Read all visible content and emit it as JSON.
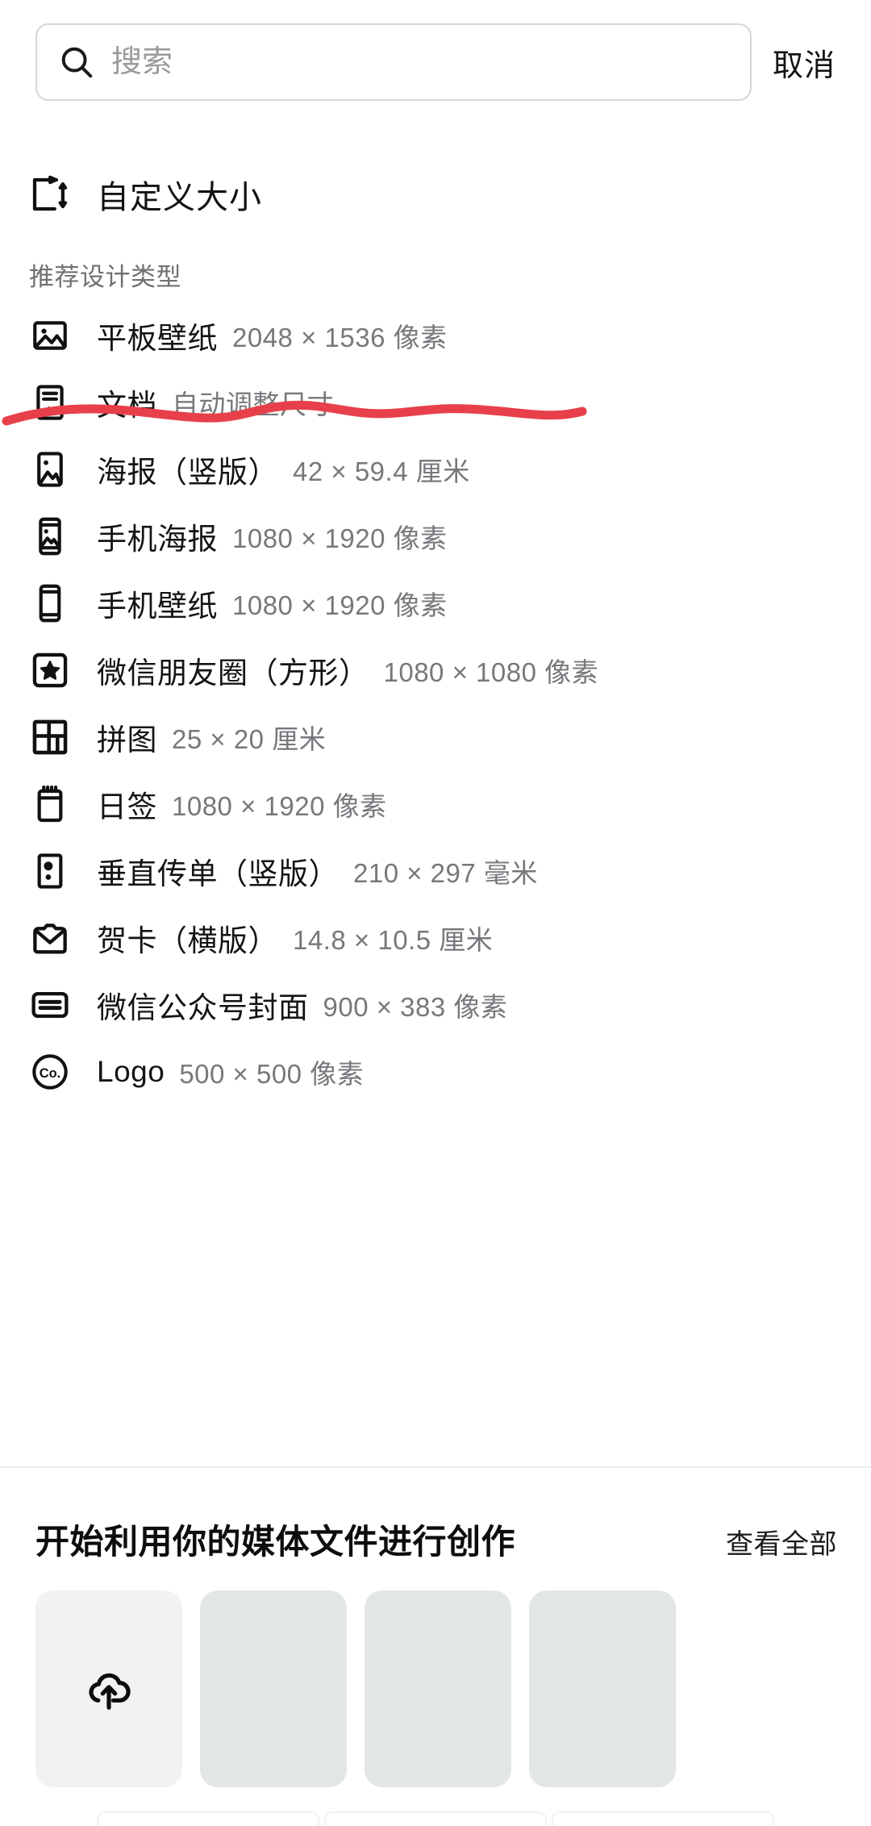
{
  "search": {
    "placeholder": "搜索",
    "value": "",
    "icon": "search-icon",
    "cancel_label": "取消"
  },
  "custom_size": {
    "label": "自定义大小",
    "icon": "resize-icon"
  },
  "section": {
    "header": "推荐设计类型"
  },
  "design_types": [
    {
      "icon": "image-icon",
      "label": "平板壁纸",
      "dimension": "2048 × 1536 像素"
    },
    {
      "icon": "document-icon",
      "label": "文档",
      "dimension": "自动调整尺寸"
    },
    {
      "icon": "poster-icon",
      "label": "海报（竖版）",
      "dimension": "42 × 59.4 厘米"
    },
    {
      "icon": "phone-poster-icon",
      "label": "手机海报",
      "dimension": "1080 × 1920 像素"
    },
    {
      "icon": "phone-icon",
      "label": "手机壁纸",
      "dimension": "1080 × 1920 像素"
    },
    {
      "icon": "star-square-icon",
      "label": "微信朋友圈（方形）",
      "dimension": "1080 × 1080 像素"
    },
    {
      "icon": "collage-icon",
      "label": "拼图",
      "dimension": "25 × 20 厘米"
    },
    {
      "icon": "notepad-icon",
      "label": "日签",
      "dimension": "1080 × 1920 像素"
    },
    {
      "icon": "flyer-icon",
      "label": "垂直传单（竖版）",
      "dimension": "210 × 297 毫米"
    },
    {
      "icon": "envelope-icon",
      "label": "贺卡（横版）",
      "dimension": "14.8 × 10.5 厘米"
    },
    {
      "icon": "wechat-cover-icon",
      "label": "微信公众号封面",
      "dimension": "900 × 383 像素"
    },
    {
      "icon": "logo-circle-icon",
      "label": "Logo",
      "dimension": "500 × 500 像素"
    }
  ],
  "annotation": {
    "type": "handdrawn-underline",
    "color": "#e8404a",
    "target": "平板壁纸"
  },
  "media_section": {
    "title": "开始利用你的媒体文件进行创作",
    "view_all_label": "查看全部",
    "tiles": [
      {
        "kind": "upload",
        "icon": "cloud-upload-icon"
      },
      {
        "kind": "placeholder"
      },
      {
        "kind": "placeholder"
      },
      {
        "kind": "placeholder"
      }
    ]
  },
  "colors": {
    "accent_annotation": "#e8404a",
    "text_primary": "#141414",
    "text_secondary": "#76787c",
    "tile_upload_bg": "#f0f2f3",
    "tile_placeholder_bg": "#e3e6e7",
    "border": "#d6d6d8"
  }
}
